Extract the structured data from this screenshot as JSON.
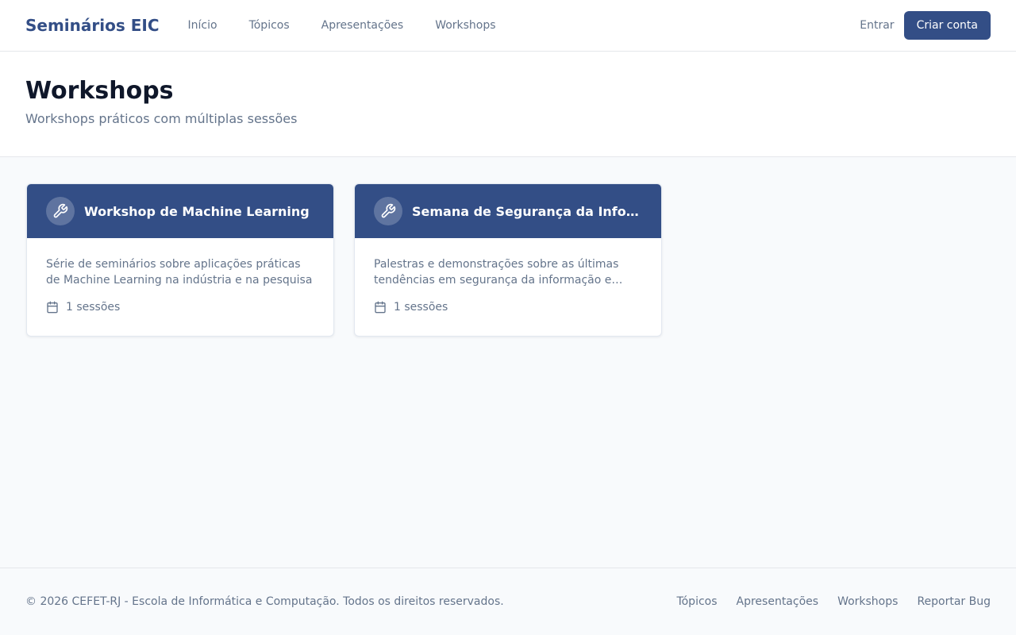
{
  "header": {
    "brand": "Seminários EIC",
    "nav": [
      {
        "label": "Início"
      },
      {
        "label": "Tópicos"
      },
      {
        "label": "Apresentações"
      },
      {
        "label": "Workshops"
      }
    ],
    "login_label": "Entrar",
    "signup_label": "Criar conta"
  },
  "page": {
    "title": "Workshops",
    "subtitle": "Workshops práticos com múltiplas sessões"
  },
  "workshops": [
    {
      "title": "Workshop de Machine Learning",
      "icon": "wrench-icon",
      "description": "Série de seminários sobre aplicações práticas de Machine Learning na indústria e na pesquisa",
      "sessions": "1 sessões"
    },
    {
      "title": "Semana de Segurança da Informação",
      "icon": "wrench-icon",
      "description": "Palestras e demonstrações sobre as últimas tendências em segurança da informação e cibersegurança",
      "sessions": "1 sessões"
    }
  ],
  "footer": {
    "copyright": "© 2026 CEFET-RJ - Escola de Informática e Computação. Todos os direitos reservados.",
    "links": [
      {
        "label": "Tópicos"
      },
      {
        "label": "Apresentações"
      },
      {
        "label": "Workshops"
      },
      {
        "label": "Reportar Bug"
      }
    ]
  },
  "colors": {
    "primary": "#334e86",
    "muted_text": "#64748b",
    "background": "#f8fafc"
  }
}
